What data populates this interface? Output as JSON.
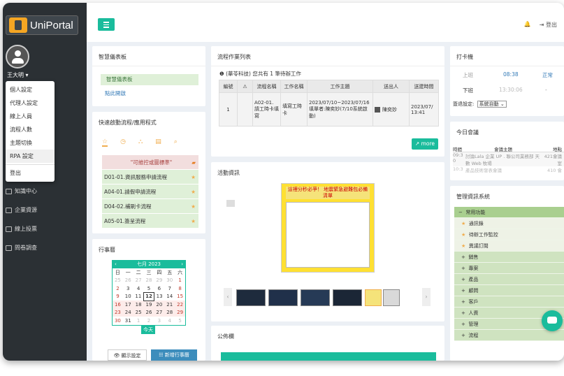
{
  "app": {
    "logo_text": "UniPortal"
  },
  "user": {
    "name": "王大明 ▾"
  },
  "user_menu": [
    "個人設定",
    "代理人設定",
    "線上人員",
    "流程人數",
    "主題切換",
    "RPA 設定",
    "登出"
  ],
  "sidebar": {
    "items": [
      {
        "label": "知識中心",
        "icon": "book-icon"
      },
      {
        "label": "企業資源",
        "icon": "folder-icon"
      },
      {
        "label": "線上投票",
        "icon": "chart-icon"
      },
      {
        "label": "問卷調查",
        "icon": "survey-icon"
      }
    ]
  },
  "topbar": {
    "bell": "🔔",
    "logout": "⇥ 登出"
  },
  "dashboard": {
    "title": "智慧儀表板",
    "item": "智慧儀表板",
    "link": "點此開啟"
  },
  "quick": {
    "title": "快速啟動流程/應用程式",
    "notice": "\"可維控或圖標準\"",
    "items": [
      "D01-01.資訊服務申請流程",
      "A04-01.請假申請流程",
      "D04-02.補刷卡流程",
      "A05-01.簽呈流程"
    ]
  },
  "calendar": {
    "title": "行事曆",
    "month": "七月 2023",
    "weekdays": [
      "日",
      "一",
      "二",
      "三",
      "四",
      "五",
      "六"
    ],
    "weeks": [
      [
        "25",
        "26",
        "27",
        "28",
        "29",
        "30",
        "1"
      ],
      [
        "2",
        "3",
        "4",
        "5",
        "6",
        "7",
        "8"
      ],
      [
        "9",
        "10",
        "11",
        "12",
        "13",
        "14",
        "15"
      ],
      [
        "16",
        "17",
        "18",
        "19",
        "20",
        "21",
        "22"
      ],
      [
        "23",
        "24",
        "25",
        "26",
        "27",
        "28",
        "29"
      ],
      [
        "30",
        "31",
        "1",
        "2",
        "3",
        "4",
        "5"
      ]
    ],
    "today": "今天",
    "settings_btn": "👁 顯示設定",
    "add_btn": "☷ 新增行事曆"
  },
  "workflow": {
    "title": "流程作業列表",
    "summary": "❶ (華苓科技) 您共有 1 筆待辦工作",
    "headers": [
      "編號",
      "⚠",
      "流程名稱",
      "工作名稱",
      "工作主題",
      "送出人",
      "送建時間"
    ],
    "row": [
      "1",
      "",
      "A02-01. 請工時卡填寫",
      "填寫工時卡",
      "2023/07/10~2023/07/16 填單者:陳奕妙(7/10系統啟動)",
      "陳奕妙",
      "2023/07/ 13:41"
    ],
    "more": "↗ more"
  },
  "activity": {
    "title": "活動資訊",
    "poster_title": "這裡分秒必爭！ 地震緊急避難包必備清單"
  },
  "announcement": {
    "title": "公佈欄"
  },
  "clock": {
    "title": "打卡機",
    "rows": [
      {
        "label": "上班",
        "time": "08:38",
        "status": "正常"
      },
      {
        "label": "下班",
        "time": "13:30:06",
        "status": "-"
      }
    ],
    "setting_label": "簽退設定:",
    "setting_value": "系統自動 ⌄"
  },
  "meeting": {
    "title": "今日會議",
    "headers": [
      "時間",
      "會議主題",
      "地點"
    ],
    "rows": [
      [
        "09:3 0",
        "討論Lala 企業 UP . 聯公司業務部 天數 Web 牧場",
        "421會議室"
      ],
      [
        "10:3",
        "產品技術發表會議",
        "410 會"
      ]
    ]
  },
  "management": {
    "title": "管理資訊系統",
    "items": [
      {
        "label": "常用功能",
        "type": "head"
      },
      {
        "label": "通訊錄",
        "type": "star"
      },
      {
        "label": "待辦工作監控",
        "type": "star"
      },
      {
        "label": "異議訂閱",
        "type": "star"
      },
      {
        "label": "銷售",
        "type": "plus"
      },
      {
        "label": "專案",
        "type": "plus"
      },
      {
        "label": "產品",
        "type": "plus"
      },
      {
        "label": "顧問",
        "type": "plus"
      },
      {
        "label": "客戶",
        "type": "plus"
      },
      {
        "label": "人資",
        "type": "plus"
      },
      {
        "label": "管理",
        "type": "plus"
      },
      {
        "label": "流程",
        "type": "plus"
      }
    ]
  },
  "colors": {
    "accent": "#1abc9c",
    "sidebar": "#2b3034",
    "star": "#f0ad4e",
    "link": "#337ab7"
  }
}
